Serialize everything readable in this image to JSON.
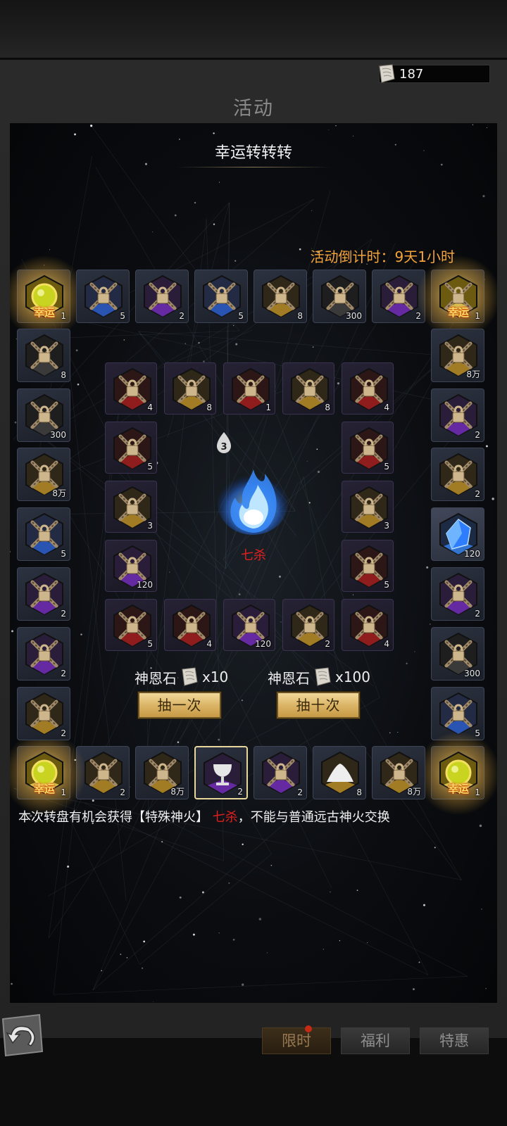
{
  "header": {
    "currency_amount": "187",
    "currency_icon": "scroll-stone-icon"
  },
  "page_title": "活动",
  "wheel": {
    "title": "幸运转转转",
    "countdown": "活动倒计时：9天1小时",
    "center_counter": "3",
    "center_item_name": "七杀",
    "outer_slots": [
      {
        "count": "1",
        "tag": "幸运",
        "icon": "lucky-orb-icon",
        "theme": "lucky"
      },
      {
        "count": "5",
        "icon": "locked-item-icon",
        "theme": "blue"
      },
      {
        "count": "2",
        "icon": "locked-item-icon",
        "theme": "purple"
      },
      {
        "count": "5",
        "icon": "locked-item-icon",
        "theme": "blue"
      },
      {
        "count": "8",
        "icon": "locked-item-icon",
        "theme": "gold"
      },
      {
        "count": "300",
        "icon": "locked-item-icon",
        "theme": "plain"
      },
      {
        "count": "2",
        "icon": "locked-item-icon",
        "theme": "purple"
      },
      {
        "count": "1",
        "tag": "幸运",
        "icon": "locked-item-icon",
        "theme": "lucky"
      },
      {
        "count": "8万",
        "icon": "locked-item-icon",
        "theme": "gold"
      },
      {
        "count": "2",
        "icon": "locked-item-icon",
        "theme": "purple"
      },
      {
        "count": "2",
        "icon": "locked-item-icon",
        "theme": "gold"
      },
      {
        "count": "120",
        "icon": "blue-crystal-icon",
        "theme": "crystal"
      },
      {
        "count": "2",
        "icon": "locked-item-icon",
        "theme": "purple"
      },
      {
        "count": "300",
        "icon": "locked-item-icon",
        "theme": "plain"
      },
      {
        "count": "5",
        "icon": "locked-item-icon",
        "theme": "blue"
      },
      {
        "count": "1",
        "tag": "幸运",
        "icon": "lucky-orb-icon",
        "theme": "lucky"
      },
      {
        "count": "8万",
        "icon": "locked-item-icon",
        "theme": "gold"
      },
      {
        "count": "8",
        "icon": "white-powder-icon",
        "theme": "gold"
      },
      {
        "count": "2",
        "icon": "locked-item-icon",
        "theme": "purple"
      },
      {
        "count": "2",
        "icon": "silver-chalice-icon",
        "theme": "purple"
      },
      {
        "count": "8万",
        "icon": "locked-item-icon",
        "theme": "gold"
      },
      {
        "count": "2",
        "icon": "locked-item-icon",
        "theme": "gold"
      },
      {
        "count": "1",
        "tag": "幸运",
        "icon": "lucky-orb-icon",
        "theme": "lucky"
      },
      {
        "count": "2",
        "icon": "locked-item-icon",
        "theme": "gold"
      },
      {
        "count": "2",
        "icon": "locked-item-icon",
        "theme": "purple"
      },
      {
        "count": "2",
        "icon": "locked-item-icon",
        "theme": "purple"
      },
      {
        "count": "5",
        "icon": "locked-item-icon",
        "theme": "blue"
      },
      {
        "count": "8万",
        "icon": "locked-item-icon",
        "theme": "gold"
      },
      {
        "count": "300",
        "icon": "locked-item-icon",
        "theme": "plain"
      },
      {
        "count": "8",
        "icon": "locked-item-icon",
        "theme": "plain"
      }
    ],
    "inner_slots": [
      {
        "count": "4",
        "icon": "locked-item-icon",
        "theme": "red"
      },
      {
        "count": "8",
        "icon": "locked-item-icon",
        "theme": "gold"
      },
      {
        "count": "1",
        "icon": "locked-item-icon",
        "theme": "red"
      },
      {
        "count": "8",
        "icon": "locked-item-icon",
        "theme": "gold"
      },
      {
        "count": "4",
        "icon": "locked-item-icon",
        "theme": "red"
      },
      {
        "count": "5",
        "icon": "locked-item-icon",
        "theme": "red"
      },
      {
        "count": "3",
        "icon": "locked-item-icon",
        "theme": "gold"
      },
      {
        "count": "5",
        "icon": "locked-item-icon",
        "theme": "red"
      },
      {
        "count": "4",
        "icon": "locked-item-icon",
        "theme": "red"
      },
      {
        "count": "2",
        "icon": "locked-item-icon",
        "theme": "gold"
      },
      {
        "count": "120",
        "icon": "locked-item-icon",
        "theme": "purple"
      },
      {
        "count": "4",
        "icon": "locked-item-icon",
        "theme": "red"
      },
      {
        "count": "5",
        "icon": "locked-item-icon",
        "theme": "red"
      },
      {
        "count": "120",
        "icon": "locked-item-icon",
        "theme": "purple"
      },
      {
        "count": "3",
        "icon": "locked-item-icon",
        "theme": "gold"
      },
      {
        "count": "5",
        "icon": "locked-item-icon",
        "theme": "red"
      }
    ],
    "draw_once": {
      "cost_label": "神恩石",
      "cost_amount": "x10",
      "button": "抽一次"
    },
    "draw_ten": {
      "cost_label": "神恩石",
      "cost_amount": "x100",
      "button": "抽十次"
    },
    "note_prefix": "本次转盘有机会获得【特殊神火】",
    "note_highlight": "七杀",
    "note_suffix": "，不能与普通远古神火交换"
  },
  "tabs": [
    {
      "label": "限时",
      "active": true
    },
    {
      "label": "福利",
      "active": false
    },
    {
      "label": "特惠",
      "active": false
    }
  ],
  "colors": {
    "countdown": "#f4a43a",
    "highlight_red": "#e02020",
    "lucky_tag": "#ffdd66",
    "button_gold": "#d9b263",
    "flame_blue": "#3a8dff"
  }
}
